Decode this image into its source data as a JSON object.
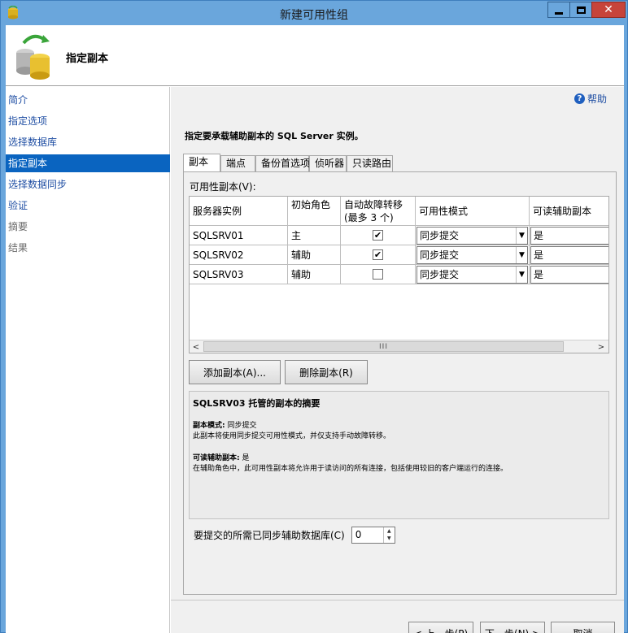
{
  "window": {
    "title": "新建可用性组"
  },
  "header": {
    "title": "指定副本"
  },
  "sidebar": {
    "items": [
      {
        "label": "简介",
        "state": "link"
      },
      {
        "label": "指定选项",
        "state": "link"
      },
      {
        "label": "选择数据库",
        "state": "link"
      },
      {
        "label": "指定副本",
        "state": "active"
      },
      {
        "label": "选择数据同步",
        "state": "link"
      },
      {
        "label": "验证",
        "state": "link"
      },
      {
        "label": "摘要",
        "state": "disabled"
      },
      {
        "label": "结果",
        "state": "disabled"
      }
    ]
  },
  "help": {
    "label": "帮助"
  },
  "instruction": "指定要承载辅助副本的 SQL Server 实例。",
  "tabs": [
    {
      "label": "副本",
      "active": true
    },
    {
      "label": "端点",
      "active": false
    },
    {
      "label": "备份首选项",
      "active": false
    },
    {
      "label": "侦听器",
      "active": false
    },
    {
      "label": "只读路由",
      "active": false
    }
  ],
  "replicas": {
    "label": "可用性副本(V):",
    "columns": [
      "服务器实例",
      "初始角色",
      "自动故障转移(最多 3 个)",
      "可用性模式",
      "可读辅助副本"
    ],
    "rows": [
      {
        "server": "SQLSRV01",
        "role": "主",
        "auto_failover": true,
        "mode": "同步提交",
        "readable": "是"
      },
      {
        "server": "SQLSRV02",
        "role": "辅助",
        "auto_failover": true,
        "mode": "同步提交",
        "readable": "是"
      },
      {
        "server": "SQLSRV03",
        "role": "辅助",
        "auto_failover": false,
        "mode": "同步提交",
        "readable": "是"
      }
    ],
    "scroll_thumb_glyph": "III"
  },
  "buttons": {
    "add_replica": "添加副本(A)...",
    "remove_replica": "删除副本(R)",
    "back": "< 上一步(P)",
    "next": "下一步(N) >",
    "cancel": "取消"
  },
  "summary": {
    "title": "SQLSRV03 托管的副本的摘要",
    "mode_label": "副本模式:",
    "mode_value": "同步提交",
    "mode_desc": "此副本将使用同步提交可用性模式，并仅支持手动故障转移。",
    "readable_label": "可读辅助副本:",
    "readable_value": "是",
    "readable_desc": "在辅助角色中，此可用性副本将允许用于读访问的所有连接，包括使用较旧的客户端运行的连接。"
  },
  "sync_commit": {
    "label": "要提交的所需已同步辅助数据库(C)",
    "value": "0"
  },
  "colors": {
    "accent": "#0a64c0",
    "link": "#1f4ea3",
    "titlebar": "#6aa6dc",
    "close": "#c7443a"
  }
}
